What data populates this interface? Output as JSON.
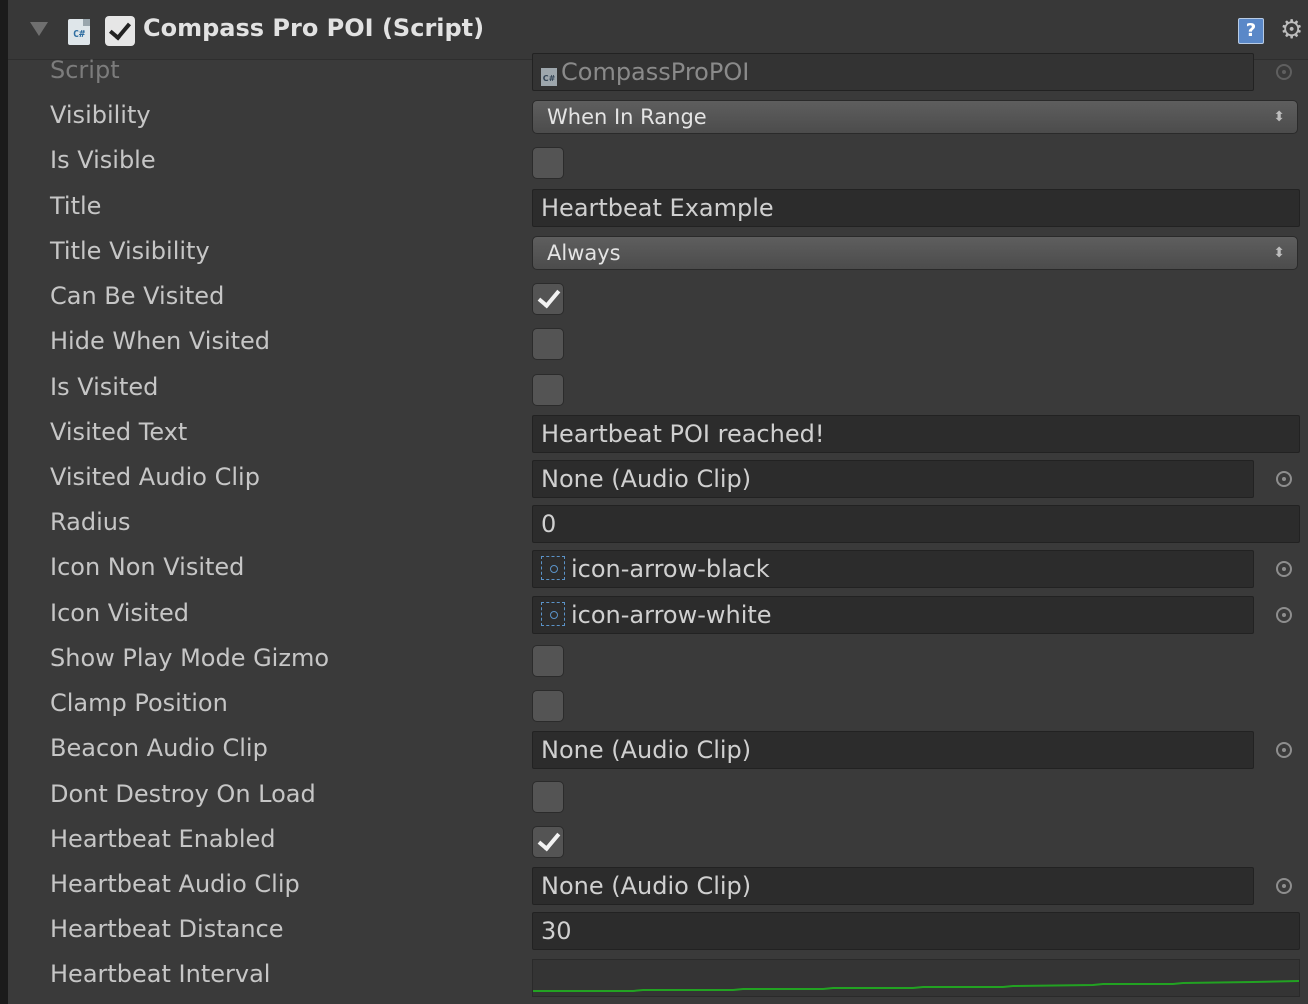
{
  "header": {
    "title": "Compass Pro POI (Script)",
    "enabled": true,
    "script_icon": "cs-script-icon",
    "help_icon": "help-icon",
    "settings_icon": "gear-icon"
  },
  "rows": {
    "script": {
      "label": "Script",
      "value": "CompassProPOI"
    },
    "visibility": {
      "label": "Visibility",
      "value": "When In Range"
    },
    "is_visible": {
      "label": "Is Visible",
      "checked": false
    },
    "title": {
      "label": "Title",
      "value": "Heartbeat Example"
    },
    "title_visibility": {
      "label": "Title Visibility",
      "value": "Always"
    },
    "can_be_visited": {
      "label": "Can Be Visited",
      "checked": true
    },
    "hide_when_visited": {
      "label": "Hide When Visited",
      "checked": false
    },
    "is_visited": {
      "label": "Is Visited",
      "checked": false
    },
    "visited_text": {
      "label": "Visited Text",
      "value": "Heartbeat POI reached!"
    },
    "visited_audio_clip": {
      "label": "Visited Audio Clip",
      "value": "None (Audio Clip)"
    },
    "radius": {
      "label": "Radius",
      "value": "0"
    },
    "icon_non_visited": {
      "label": "Icon Non Visited",
      "value": "icon-arrow-black"
    },
    "icon_visited": {
      "label": "Icon Visited",
      "value": "icon-arrow-white"
    },
    "show_play_mode_gizmo": {
      "label": "Show Play Mode Gizmo",
      "checked": false
    },
    "clamp_position": {
      "label": "Clamp Position",
      "checked": false
    },
    "beacon_audio_clip": {
      "label": "Beacon Audio Clip",
      "value": "None (Audio Clip)"
    },
    "dont_destroy_on_load": {
      "label": "Dont Destroy On Load",
      "checked": false
    },
    "heartbeat_enabled": {
      "label": "Heartbeat Enabled",
      "checked": true
    },
    "heartbeat_audio_clip": {
      "label": "Heartbeat Audio Clip",
      "value": "None (Audio Clip)"
    },
    "heartbeat_distance": {
      "label": "Heartbeat Distance",
      "value": "30"
    },
    "heartbeat_interval": {
      "label": "Heartbeat Interval",
      "curve_color": "#22a222"
    }
  }
}
